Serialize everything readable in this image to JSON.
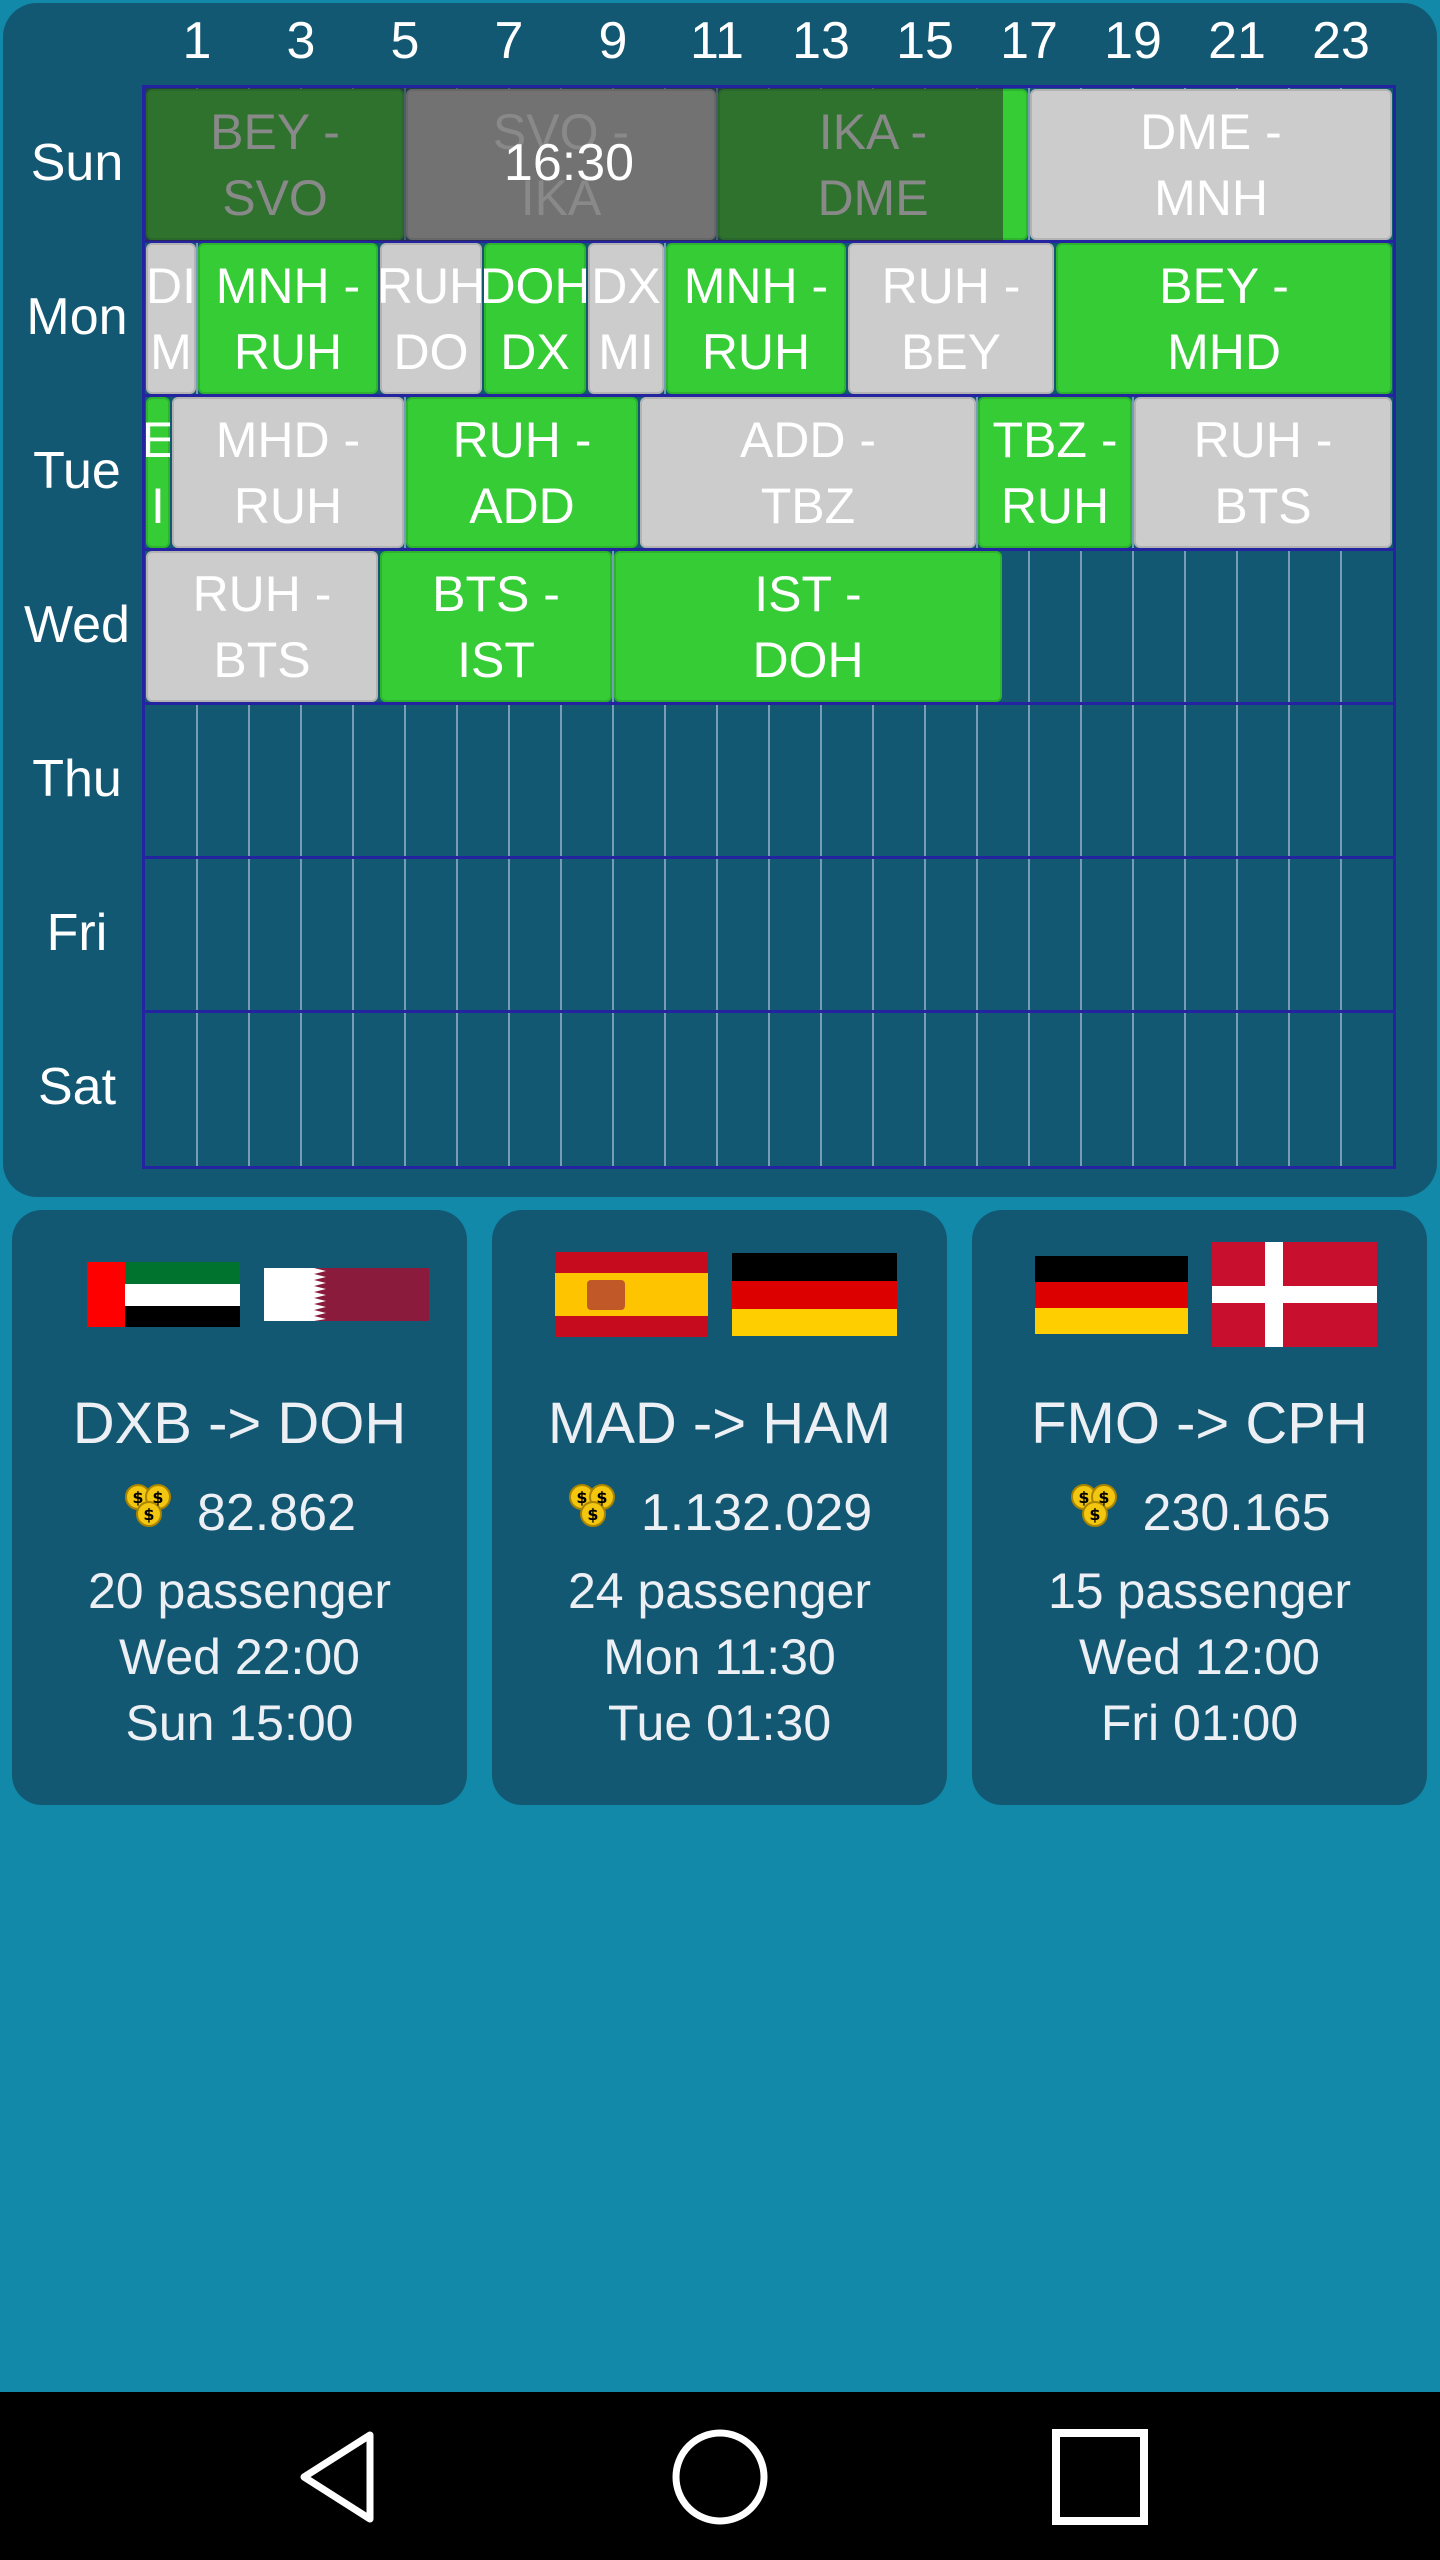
{
  "schedule": {
    "hour_labels": [
      "1",
      "3",
      "5",
      "7",
      "9",
      "11",
      "13",
      "15",
      "17",
      "19",
      "21",
      "23"
    ],
    "days": [
      "Sun",
      "Mon",
      "Tue",
      "Wed",
      "Thu",
      "Fri",
      "Sat"
    ],
    "current_time_label": "16:30",
    "current_time": {
      "day": "Sun",
      "hour": 16.5
    },
    "flights": [
      {
        "day": 0,
        "start": 0,
        "end": 5,
        "label": "BEY -\nSVO",
        "color": "green"
      },
      {
        "day": 0,
        "start": 5,
        "end": 11,
        "label": "SVO -\nIKA",
        "color": "gray"
      },
      {
        "day": 0,
        "start": 11,
        "end": 17,
        "label": "IKA -\nDME",
        "color": "green"
      },
      {
        "day": 0,
        "start": 17,
        "end": 24,
        "label": "DME -\nMNH",
        "color": "gray"
      },
      {
        "day": 1,
        "start": 0,
        "end": 1,
        "label": "DI\nM",
        "color": "gray"
      },
      {
        "day": 1,
        "start": 1,
        "end": 4.5,
        "label": "MNH -\nRUH",
        "color": "green"
      },
      {
        "day": 1,
        "start": 4.5,
        "end": 6.5,
        "label": "RUH\nDO",
        "color": "gray"
      },
      {
        "day": 1,
        "start": 6.5,
        "end": 8.5,
        "label": "DOH\nDX",
        "color": "green"
      },
      {
        "day": 1,
        "start": 8.5,
        "end": 10,
        "label": "DX\nMI",
        "color": "gray"
      },
      {
        "day": 1,
        "start": 10,
        "end": 13.5,
        "label": "MNH -\nRUH",
        "color": "green"
      },
      {
        "day": 1,
        "start": 13.5,
        "end": 17.5,
        "label": "RUH -\nBEY",
        "color": "gray"
      },
      {
        "day": 1,
        "start": 17.5,
        "end": 24,
        "label": "BEY -\nMHD",
        "color": "green"
      },
      {
        "day": 2,
        "start": 0,
        "end": 0.5,
        "label": "E\nI",
        "color": "green"
      },
      {
        "day": 2,
        "start": 0.5,
        "end": 5,
        "label": "MHD -\nRUH",
        "color": "gray"
      },
      {
        "day": 2,
        "start": 5,
        "end": 9.5,
        "label": "RUH -\nADD",
        "color": "green"
      },
      {
        "day": 2,
        "start": 9.5,
        "end": 16,
        "label": "ADD -\nTBZ",
        "color": "gray"
      },
      {
        "day": 2,
        "start": 16,
        "end": 19,
        "label": "TBZ -\nRUH",
        "color": "green"
      },
      {
        "day": 2,
        "start": 19,
        "end": 24,
        "label": "RUH -\nBTS",
        "color": "gray"
      },
      {
        "day": 3,
        "start": 0,
        "end": 4.5,
        "label": "RUH -\nBTS",
        "color": "gray"
      },
      {
        "day": 3,
        "start": 4.5,
        "end": 9,
        "label": "BTS -\nIST",
        "color": "green"
      },
      {
        "day": 3,
        "start": 9,
        "end": 16.5,
        "label": "IST -\nDOH",
        "color": "green"
      }
    ]
  },
  "offers": [
    {
      "from_flag": "uae-flag",
      "to_flag": "qatar-flag",
      "route": "DXB -> DOH",
      "money": "82.862",
      "passengers": "20 passenger",
      "depart": "Wed 22:00",
      "arrive": "Sun 15:00"
    },
    {
      "from_flag": "spain-flag",
      "to_flag": "germany-flag",
      "route": "MAD -> HAM",
      "money": "1.132.029",
      "passengers": "24 passenger",
      "depart": "Mon 11:30",
      "arrive": "Tue 01:30"
    },
    {
      "from_flag": "germany-flag",
      "to_flag": "denmark-flag",
      "route": "FMO -> CPH",
      "money": "230.165",
      "passengers": "15 passenger",
      "depart": "Wed 12:00",
      "arrive": "Fri 01:00"
    }
  ],
  "colors": {
    "background": "#1289A8",
    "panel": "#135873",
    "flight_green": "#35CC35",
    "flight_gray": "#CCCCCC",
    "grid_border": "#2424A0"
  },
  "navbar": {
    "back": "back-icon",
    "home": "home-icon",
    "recents": "recents-icon"
  }
}
